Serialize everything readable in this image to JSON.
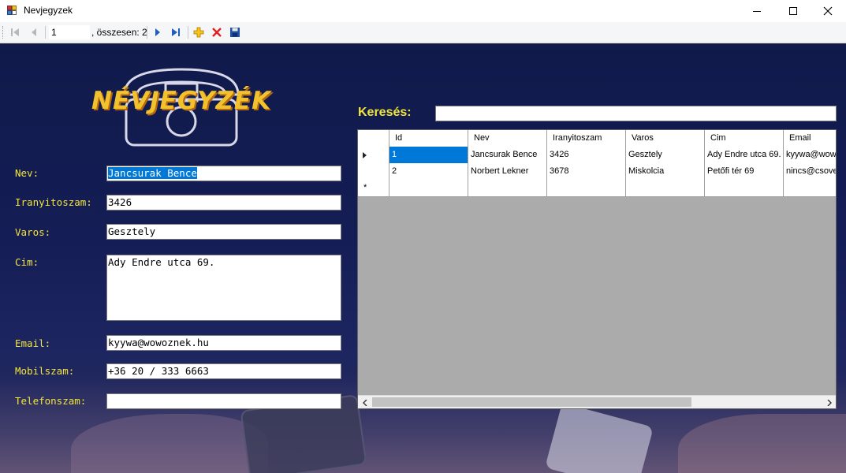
{
  "window": {
    "title": "Nevjegyzek",
    "icon": "app-window-icon"
  },
  "toolbar": {
    "position_value": "1",
    "count_text": ", összesen: 2",
    "icons": [
      "move-first-icon",
      "move-previous-icon",
      "move-next-icon",
      "move-last-icon",
      "add-new-icon",
      "delete-icon",
      "save-icon"
    ]
  },
  "logo": {
    "text": "NÉVJEGYZÉK",
    "icon": "telephone-icon"
  },
  "form": {
    "nev_label": "Nev:",
    "nev_value": "Jancsurak Bence",
    "iranyitoszam_label": "Iranyitoszam:",
    "iranyitoszam_value": "3426",
    "varos_label": "Varos:",
    "varos_value": "Gesztely",
    "cim_label": "Cim:",
    "cim_value": "Ady Endre utca 69.",
    "email_label": "Email:",
    "email_value": "kyywa@wowoznek.hu",
    "mobil_label": "Mobilszam:",
    "mobil_value": "+36 20 / 333 6663",
    "telefon_label": "Telefonszam:",
    "telefon_value": ""
  },
  "search": {
    "label": "Keresés:",
    "value": ""
  },
  "grid": {
    "columns": [
      "Id",
      "Nev",
      "Iranyitoszam",
      "Varos",
      "Cim",
      "Email"
    ],
    "rows": [
      [
        "1",
        "Jancsurak Bence",
        "3426",
        "Gesztely",
        "Ady Endre utca 69.",
        "kyywa@wow"
      ],
      [
        "2",
        "Norbert Lekner",
        "3678",
        "Miskolcia",
        "Petőfi tér 69",
        "nincs@csove"
      ]
    ],
    "new_row_marker": "*",
    "selected_row": 0,
    "selected_column": "Id"
  },
  "colors": {
    "label_yellow": "#f3e63a",
    "background_navy": "#141d55",
    "selection_blue": "#0078d7",
    "logo_gold": "#f2c12e"
  }
}
